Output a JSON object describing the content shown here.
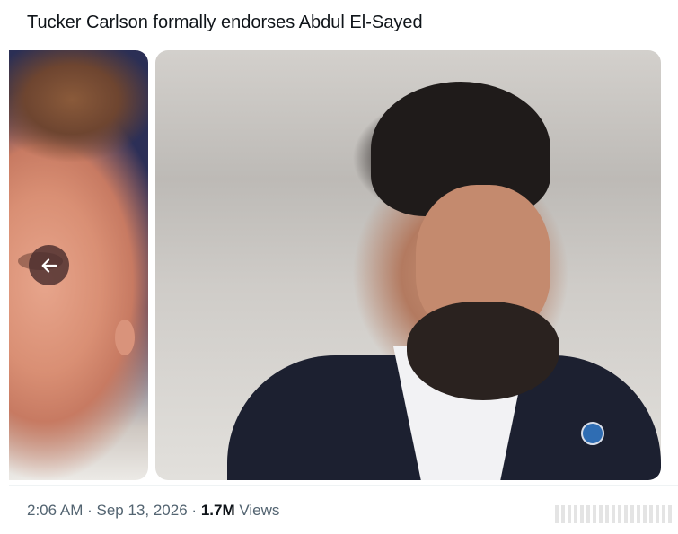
{
  "tweet": {
    "text": "Tucker Carlson formally endorses Abdul El-Sayed"
  },
  "media": {
    "left_image": "tucker-carlson-portrait",
    "right_image": "abdul-el-sayed-portrait",
    "back_button_icon": "arrow-left-icon"
  },
  "meta": {
    "time": "2:06 AM",
    "sep1": "·",
    "date": "Sep 13, 2026",
    "sep2": "·",
    "views_count": "1.7M",
    "views_label": "Views"
  },
  "colors": {
    "text_primary": "#0f1419",
    "text_secondary": "#536471",
    "button_bg": "#4b2d2d"
  }
}
